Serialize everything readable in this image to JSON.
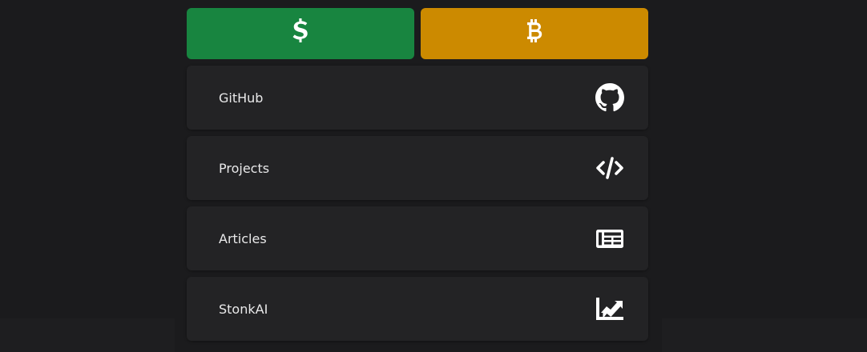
{
  "colors": {
    "usd_button": "#188540",
    "btc_button": "#cc8a00",
    "card_bg": "#232325",
    "text": "#e9e9ea",
    "icon": "#ffffff"
  },
  "donate": {
    "usd_icon": "dollar-sign-icon",
    "btc_icon": "bitcoin-icon"
  },
  "links": [
    {
      "label": "GitHub",
      "icon": "github-icon"
    },
    {
      "label": "Projects",
      "icon": "code-icon"
    },
    {
      "label": "Articles",
      "icon": "newspaper-icon"
    },
    {
      "label": "StonkAI",
      "icon": "chart-line-icon"
    }
  ]
}
